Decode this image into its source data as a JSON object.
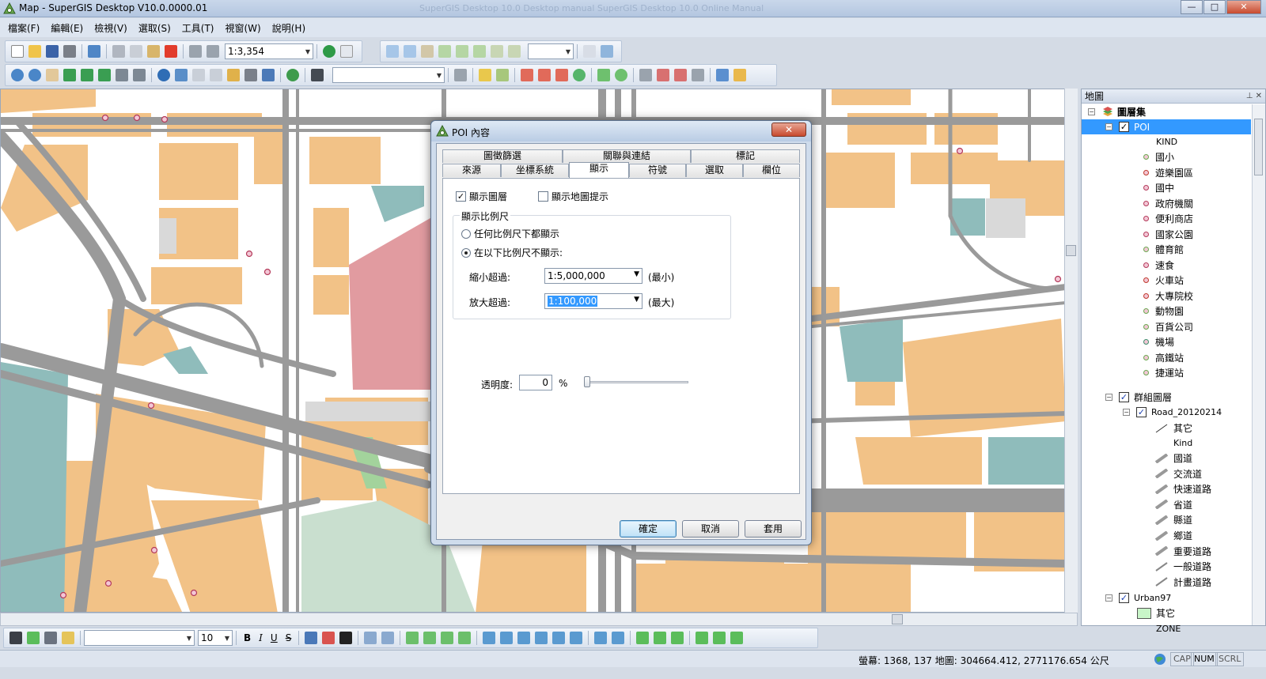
{
  "window": {
    "title": "Map - SuperGIS Desktop V10.0.0000.01",
    "ghost_title": "SuperGIS Desktop 10.0 Desktop manual SuperGIS Desktop 10.0 Online Manual",
    "btn_min": "—",
    "btn_max": "□",
    "btn_close": "✕"
  },
  "menu": [
    "檔案(F)",
    "編輯(E)",
    "檢視(V)",
    "選取(S)",
    "工具(T)",
    "視窗(W)",
    "說明(H)"
  ],
  "toolbar": {
    "scale_value": "1:3,354",
    "combo_arrow": "▼"
  },
  "layer_panel": {
    "title": "地圖",
    "pin": "⊥ ✕",
    "root": "圖層集",
    "poi_layer": "POI",
    "kind_field": "KIND",
    "poi_categories": [
      "國小",
      "遊樂園區",
      "國中",
      "政府機關",
      "便利商店",
      "國家公園",
      "體育館",
      "速食",
      "火車站",
      "大專院校",
      "動物園",
      "百貨公司",
      "機場",
      "高鐵站",
      "捷運站"
    ],
    "group_layer": "群組圖層",
    "road_layer": "Road_20120214",
    "road_other": "其它",
    "road_kind_field": "Kind",
    "road_categories": [
      "國道",
      "交流道",
      "快速道路",
      "省道",
      "縣道",
      "鄉道",
      "重要道路",
      "一般道路",
      "計畫道路"
    ],
    "urban_layer": "Urban97",
    "urban_other": "其它",
    "zone_field": "ZONE",
    "expand_minus": "−",
    "check_mark": "✓"
  },
  "bottom_toolbar": {
    "font_size": "10",
    "bold": "B",
    "italic": "I",
    "underline": "U",
    "strike": "S"
  },
  "status": {
    "coords": "螢幕: 1368, 137  地圖: 304664.412, 2771176.654 公尺",
    "cap": "CAP",
    "num": "NUM",
    "scrl": "SCRL"
  },
  "dialog": {
    "title": "POI 內容",
    "close": "✕",
    "tabs_row1": [
      "圖徵篩選",
      "關聯與連結",
      "標記"
    ],
    "tabs_row2": [
      "來源",
      "坐標系統",
      "顯示",
      "符號",
      "選取",
      "欄位"
    ],
    "show_layer": "顯示圖層",
    "show_layer_checked": true,
    "show_map_tips": "顯示地圖提示",
    "show_map_tips_checked": false,
    "scale_group": "顯示比例尺",
    "radio_any": "任何比例尺下都顯示",
    "radio_range": "在以下比例尺不顯示:",
    "selected_radio": "radio_range",
    "zoom_out_label": "縮小超過:",
    "zoom_out_value": "1:5,000,000",
    "zoom_out_suffix": "(最小)",
    "zoom_in_label": "放大超過:",
    "zoom_in_value": "1:100,000",
    "zoom_in_suffix": "(最大)",
    "transparency_label": "透明度:",
    "transparency_value": "0",
    "transparency_unit": "%",
    "transparency_level": 0,
    "btn_ok": "確定",
    "btn_cancel": "取消",
    "btn_apply": "套用"
  },
  "colors": {
    "parcel": "#f2c287",
    "road": "#9a9a9a",
    "teal": "#8fbcbb",
    "pink": "#e19ba0",
    "green": "#a3d39c",
    "poi_point": "#f3c7d6",
    "accent": "#3399ff"
  }
}
